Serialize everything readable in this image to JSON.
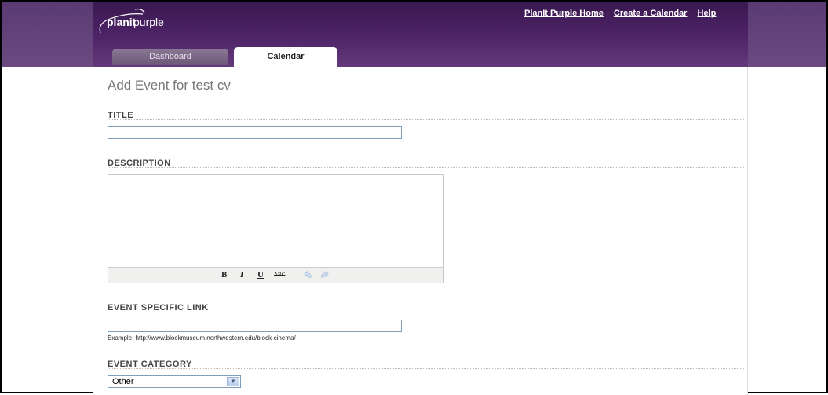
{
  "app": {
    "logo_text_part1": "planit",
    "logo_text_part2": "purple"
  },
  "top_nav": {
    "links": [
      "PlanIt Purple Home",
      "Create a Calendar",
      "Help"
    ]
  },
  "tabs": [
    {
      "label": "Dashboard",
      "active": false
    },
    {
      "label": "Calendar",
      "active": true
    }
  ],
  "page": {
    "title": "Add Event for test cv"
  },
  "form": {
    "title": {
      "label": "TITLE",
      "value": ""
    },
    "description": {
      "label": "DESCRIPTION",
      "value": ""
    },
    "event_link": {
      "label": "EVENT SPECIFIC LINK",
      "value": "",
      "hint": "Example: http://www.blockmuseum.northwestern.edu/block-cinema/"
    },
    "event_category": {
      "label": "EVENT CATEGORY",
      "selected": "Other"
    }
  },
  "editor_toolbar": {
    "bold": "B",
    "italic": "I",
    "underline": "U",
    "strike": "ABC",
    "undo_icon": "undo-icon",
    "redo_icon": "redo-icon"
  },
  "colors": {
    "header_dark": "#3a1850",
    "header_light": "#643a7c",
    "link_color": "#ffffff"
  }
}
